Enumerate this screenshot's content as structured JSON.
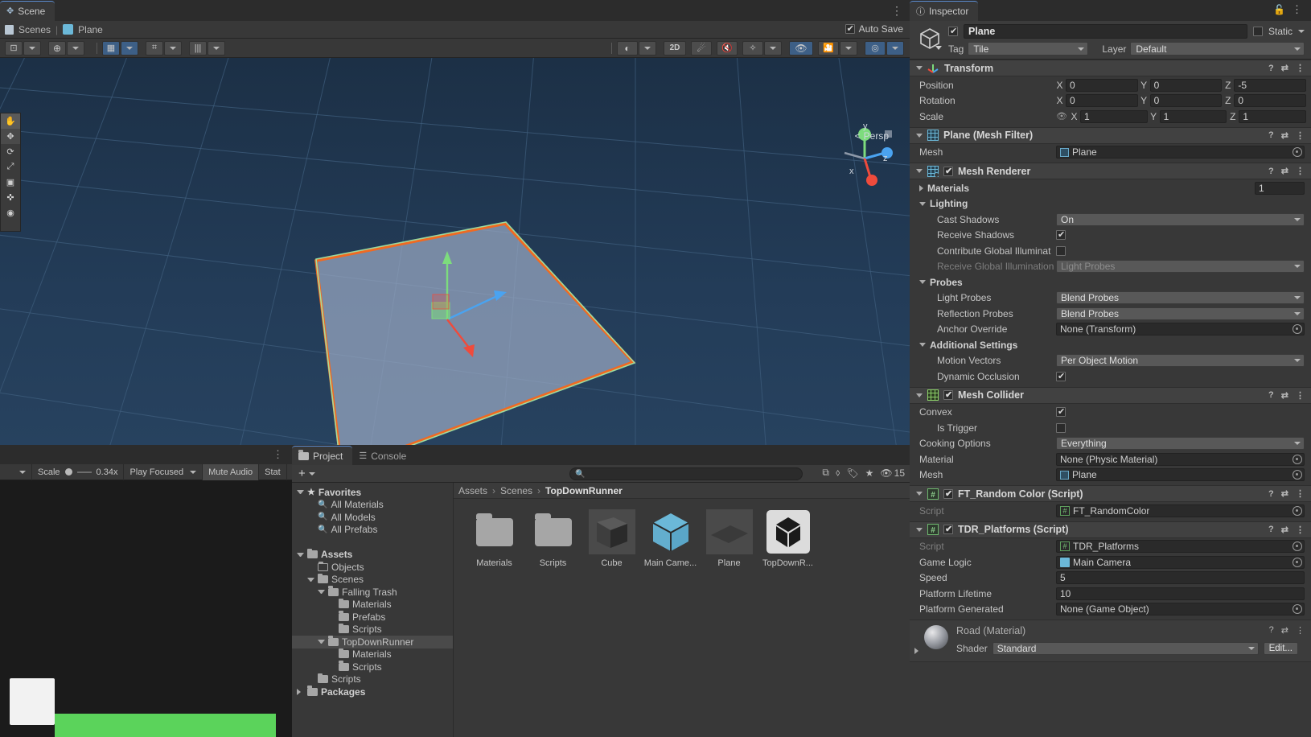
{
  "scene": {
    "tab_label": "Scene",
    "breadcrumb_scene": "Scenes",
    "breadcrumb_object": "Plane",
    "auto_save_label": "Auto Save",
    "persp_label": "Persp",
    "gizmo_axes": {
      "x": "x",
      "y": "y",
      "z": "z"
    },
    "toolbar": {
      "pivot": "pivot-icon",
      "global": "global-handle-icon",
      "grid_snap": "grid-snap-icon",
      "snap_increment": "snap-increment-icon",
      "grid_size": "grid-size-icon",
      "shading": "shading-mode-icon",
      "two_d": "2D",
      "lighting": "lighting-toggle-icon",
      "audio": "audio-toggle-icon",
      "fx": "effects-icon",
      "hidden": "hidden-objects-icon",
      "camera": "scene-camera-icon",
      "gizmos": "gizmos-icon"
    },
    "tools": [
      "hand-tool",
      "move-tool",
      "rotate-tool",
      "scale-tool",
      "rect-tool",
      "transform-tool",
      "custom-tool"
    ]
  },
  "game": {
    "scale_label": "Scale",
    "scale_value": "0.34x",
    "play_mode": "Play Focused",
    "mute_audio": "Mute Audio",
    "stats": "Stat"
  },
  "project": {
    "tabs": [
      {
        "label": "Project",
        "icon": "folder-icon",
        "active": true
      },
      {
        "label": "Console",
        "icon": "console-icon",
        "active": false
      }
    ],
    "add_label": "+",
    "search_placeholder": "",
    "search_icon": "search-icon",
    "view_count": "15",
    "tree": [
      {
        "label": "Favorites",
        "depth": 0,
        "icon": "star-icon",
        "twisty": "down",
        "bold": true
      },
      {
        "label": "All Materials",
        "depth": 1,
        "icon": "search-icon",
        "twisty": "none",
        "bold": false
      },
      {
        "label": "All Models",
        "depth": 1,
        "icon": "search-icon",
        "twisty": "none",
        "bold": false
      },
      {
        "label": "All Prefabs",
        "depth": 1,
        "icon": "search-icon",
        "twisty": "none",
        "bold": false
      },
      {
        "label": "",
        "depth": 0,
        "icon": "none",
        "twisty": "none",
        "bold": false
      },
      {
        "label": "Assets",
        "depth": 0,
        "icon": "folder-open-icon",
        "twisty": "down",
        "bold": true
      },
      {
        "label": "Objects",
        "depth": 1,
        "icon": "folder-empty-icon",
        "twisty": "none",
        "bold": false
      },
      {
        "label": "Scenes",
        "depth": 1,
        "icon": "folder-open-icon",
        "twisty": "down",
        "bold": false
      },
      {
        "label": "Falling Trash",
        "depth": 2,
        "icon": "folder-open-icon",
        "twisty": "down",
        "bold": false
      },
      {
        "label": "Materials",
        "depth": 3,
        "icon": "folder-icon",
        "twisty": "none",
        "bold": false
      },
      {
        "label": "Prefabs",
        "depth": 3,
        "icon": "folder-icon",
        "twisty": "none",
        "bold": false
      },
      {
        "label": "Scripts",
        "depth": 3,
        "icon": "folder-icon",
        "twisty": "none",
        "bold": false
      },
      {
        "label": "TopDownRunner",
        "depth": 2,
        "icon": "folder-open-icon",
        "twisty": "down",
        "bold": false,
        "selected": true
      },
      {
        "label": "Materials",
        "depth": 3,
        "icon": "folder-icon",
        "twisty": "none",
        "bold": false
      },
      {
        "label": "Scripts",
        "depth": 3,
        "icon": "folder-icon",
        "twisty": "none",
        "bold": false
      },
      {
        "label": "Scripts",
        "depth": 1,
        "icon": "folder-icon",
        "twisty": "none",
        "bold": false
      },
      {
        "label": "Packages",
        "depth": 0,
        "icon": "folder-icon",
        "twisty": "right",
        "bold": true
      }
    ],
    "breadcrumb": [
      "Assets",
      "Scenes",
      "TopDownRunner"
    ],
    "assets": [
      {
        "label": "Materials",
        "kind": "folder"
      },
      {
        "label": "Scripts",
        "kind": "folder"
      },
      {
        "label": "Cube",
        "kind": "dark-cube"
      },
      {
        "label": "Main Came...",
        "kind": "blue-cube"
      },
      {
        "label": "Plane",
        "kind": "plane"
      },
      {
        "label": "TopDownR...",
        "kind": "unity-scene"
      }
    ]
  },
  "inspector": {
    "tab_label": "Inspector",
    "lock_icon": "lock-icon",
    "kebab_icon": "kebab-menu-icon",
    "object_icon": "gameobject-cube-icon",
    "enabled": true,
    "name": "Plane",
    "static_label": "Static",
    "tag_label": "Tag",
    "tag_value": "Tile",
    "layer_label": "Layer",
    "layer_value": "Default",
    "components": [
      {
        "title": "Transform",
        "icon": "transform-axis-icon",
        "has_checkbox": false,
        "rows": [
          {
            "type": "vector3",
            "label": "Position",
            "x": "0",
            "y": "0",
            "z": "-5"
          },
          {
            "type": "vector3",
            "label": "Rotation",
            "x": "0",
            "y": "0",
            "z": "0"
          },
          {
            "type": "vector3",
            "label": "Scale",
            "x": "1",
            "y": "1",
            "z": "1",
            "lock_icon": "scale-lock-off-icon"
          }
        ]
      },
      {
        "title": "Plane (Mesh Filter)",
        "icon": "mesh-filter-icon",
        "has_checkbox": false,
        "rows": [
          {
            "type": "object",
            "label": "Mesh",
            "value": "Plane",
            "value_icon": "mesh-icon"
          }
        ]
      },
      {
        "title": "Mesh Renderer",
        "icon": "mesh-renderer-icon",
        "has_checkbox": true,
        "checked": true,
        "rows": [
          {
            "type": "foldout-count",
            "label": "Materials",
            "twisty": "right",
            "count": "1"
          },
          {
            "type": "section",
            "label": "Lighting",
            "twisty": "down"
          },
          {
            "type": "dropdown",
            "label": "Cast Shadows",
            "value": "On",
            "indent": 1
          },
          {
            "type": "checkbox",
            "label": "Receive Shadows",
            "checked": true,
            "indent": 1
          },
          {
            "type": "checkbox",
            "label": "Contribute Global Illuminat",
            "checked": false,
            "indent": 1
          },
          {
            "type": "dropdown",
            "label": "Receive Global Illumination",
            "value": "Light Probes",
            "indent": 1,
            "dim": true
          },
          {
            "type": "section",
            "label": "Probes",
            "twisty": "down"
          },
          {
            "type": "dropdown",
            "label": "Light Probes",
            "value": "Blend Probes",
            "indent": 1
          },
          {
            "type": "dropdown",
            "label": "Reflection Probes",
            "value": "Blend Probes",
            "indent": 1
          },
          {
            "type": "object",
            "label": "Anchor Override",
            "value": "None (Transform)",
            "indent": 1
          },
          {
            "type": "section",
            "label": "Additional Settings",
            "twisty": "down"
          },
          {
            "type": "dropdown",
            "label": "Motion Vectors",
            "value": "Per Object Motion",
            "indent": 1
          },
          {
            "type": "checkbox",
            "label": "Dynamic Occlusion",
            "checked": true,
            "indent": 1
          }
        ]
      },
      {
        "title": "Mesh Collider",
        "icon": "mesh-collider-icon",
        "has_checkbox": true,
        "checked": true,
        "rows": [
          {
            "type": "checkbox",
            "label": "Convex",
            "checked": true
          },
          {
            "type": "checkbox",
            "label": "Is Trigger",
            "checked": false,
            "indent": 1
          },
          {
            "type": "dropdown",
            "label": "Cooking Options",
            "value": "Everything"
          },
          {
            "type": "object",
            "label": "Material",
            "value": "None (Physic Material)"
          },
          {
            "type": "object",
            "label": "Mesh",
            "value": "Plane",
            "value_icon": "mesh-icon"
          }
        ]
      },
      {
        "title": "FT_Random Color (Script)",
        "icon": "script-icon",
        "has_checkbox": true,
        "checked": true,
        "rows": [
          {
            "type": "object",
            "label": "Script",
            "value": "FT_RandomColor",
            "value_icon": "script-icon",
            "dim": true
          }
        ]
      },
      {
        "title": "TDR_Platforms (Script)",
        "icon": "script-icon",
        "has_checkbox": true,
        "checked": true,
        "rows": [
          {
            "type": "object",
            "label": "Script",
            "value": "TDR_Platforms",
            "value_icon": "script-icon",
            "dim": true
          },
          {
            "type": "object",
            "label": "Game Logic",
            "value": "Main Camera",
            "value_icon": "prefab-icon"
          },
          {
            "type": "text",
            "label": "Speed",
            "value": "5"
          },
          {
            "type": "text",
            "label": "Platform Lifetime",
            "value": "10"
          },
          {
            "type": "object",
            "label": "Platform Generated",
            "value": "None (Game Object)"
          }
        ]
      }
    ],
    "material_preview": {
      "title": "Road (Material)",
      "shader_label": "Shader",
      "shader_value": "Standard",
      "edit_label": "Edit..."
    }
  },
  "colors": {
    "accent_blue": "#3d5f86",
    "panel_bg": "#383838",
    "header_bg": "#2c2c2c",
    "selection": "#4a4a4a",
    "viewport_blue": "#223a55",
    "outline_orange": "#f06a22",
    "green": "#5bd35b",
    "cyan_cube": "#6bb8d8"
  }
}
